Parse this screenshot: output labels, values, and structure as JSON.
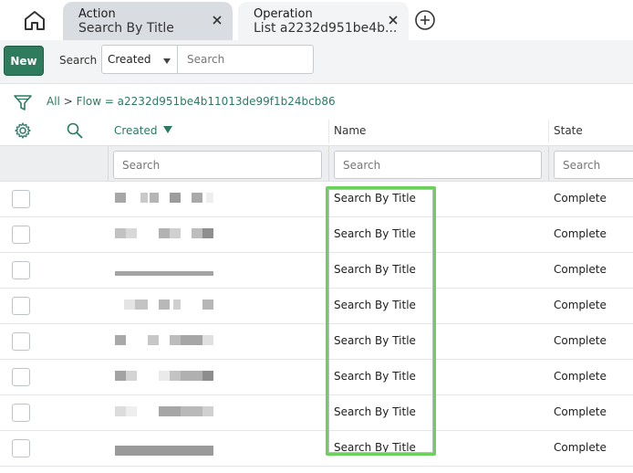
{
  "tabs": [
    {
      "kind": "Action",
      "title": "Search By Title"
    },
    {
      "kind": "Operation",
      "title": "List a2232d951be4b..."
    }
  ],
  "toolbar": {
    "new_label": "New",
    "search_label": "Search",
    "field_select": "Created",
    "search_placeholder": "Search"
  },
  "breadcrumb": {
    "all": "All",
    "separator": ">",
    "filter": "Flow = a2232d951be4b11013de99f1b24bcb86"
  },
  "columns": {
    "created": "Created",
    "name": "Name",
    "state": "State"
  },
  "column_search": {
    "created_placeholder": "Search",
    "name_placeholder": "Search",
    "state_placeholder": "Search"
  },
  "rows": [
    {
      "name": "Search By Title",
      "state": "Complete"
    },
    {
      "name": "Search By Title",
      "state": "Complete"
    },
    {
      "name": "Search By Title",
      "state": "Complete"
    },
    {
      "name": "Search By Title",
      "state": "Complete"
    },
    {
      "name": "Search By Title",
      "state": "Complete"
    },
    {
      "name": "Search By Title",
      "state": "Complete"
    },
    {
      "name": "Search By Title",
      "state": "Complete"
    },
    {
      "name": "Search By Title",
      "state": "Complete"
    }
  ],
  "colors": {
    "accent": "#2c7a64",
    "new_button": "#2e7b5e",
    "highlight": "#6bd05c"
  }
}
